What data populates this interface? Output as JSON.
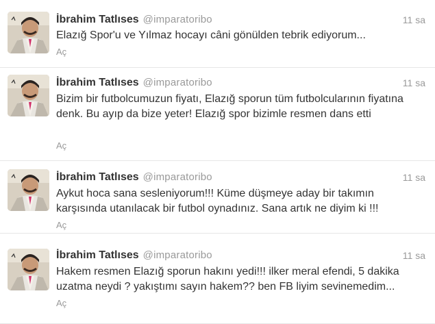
{
  "tweets": [
    {
      "name": "İbrahim Tatlıses",
      "handle": "@imparatoribo",
      "time": "11 sa",
      "text": "Elazığ Spor'u ve Yılmaz hocayı câni gönülden tebrik ediyorum...",
      "action": "Aç"
    },
    {
      "name": "İbrahim Tatlıses",
      "handle": "@imparatoribo",
      "time": "11 sa",
      "text": "Bizim bir futbolcumuzun fiyatı, Elazığ sporun tüm futbolcularının fiyatına denk. Bu ayıp da bize yeter! Elazığ spor bizimle resmen dans etti",
      "action": "Aç"
    },
    {
      "name": "İbrahim Tatlıses",
      "handle": "@imparatoribo",
      "time": "11 sa",
      "text": "Aykut hoca sana sesleniyorum!!! Küme düşmeye aday bir takımın karşısında utanılacak bir futbol oynadınız. Sana artık ne diyim ki !!!",
      "action": "Aç"
    },
    {
      "name": "İbrahim Tatlıses",
      "handle": "@imparatoribo",
      "time": "11 sa",
      "text": "Hakem resmen Elazığ sporun hakını yedi!!! ilker meral efendi, 5 dakika uzatma neydi ? yakıştımı sayın hakem?? ben FB liyim sevinemedim...",
      "action": "Aç"
    }
  ],
  "icons": {
    "avatar": "avatar-icon"
  }
}
